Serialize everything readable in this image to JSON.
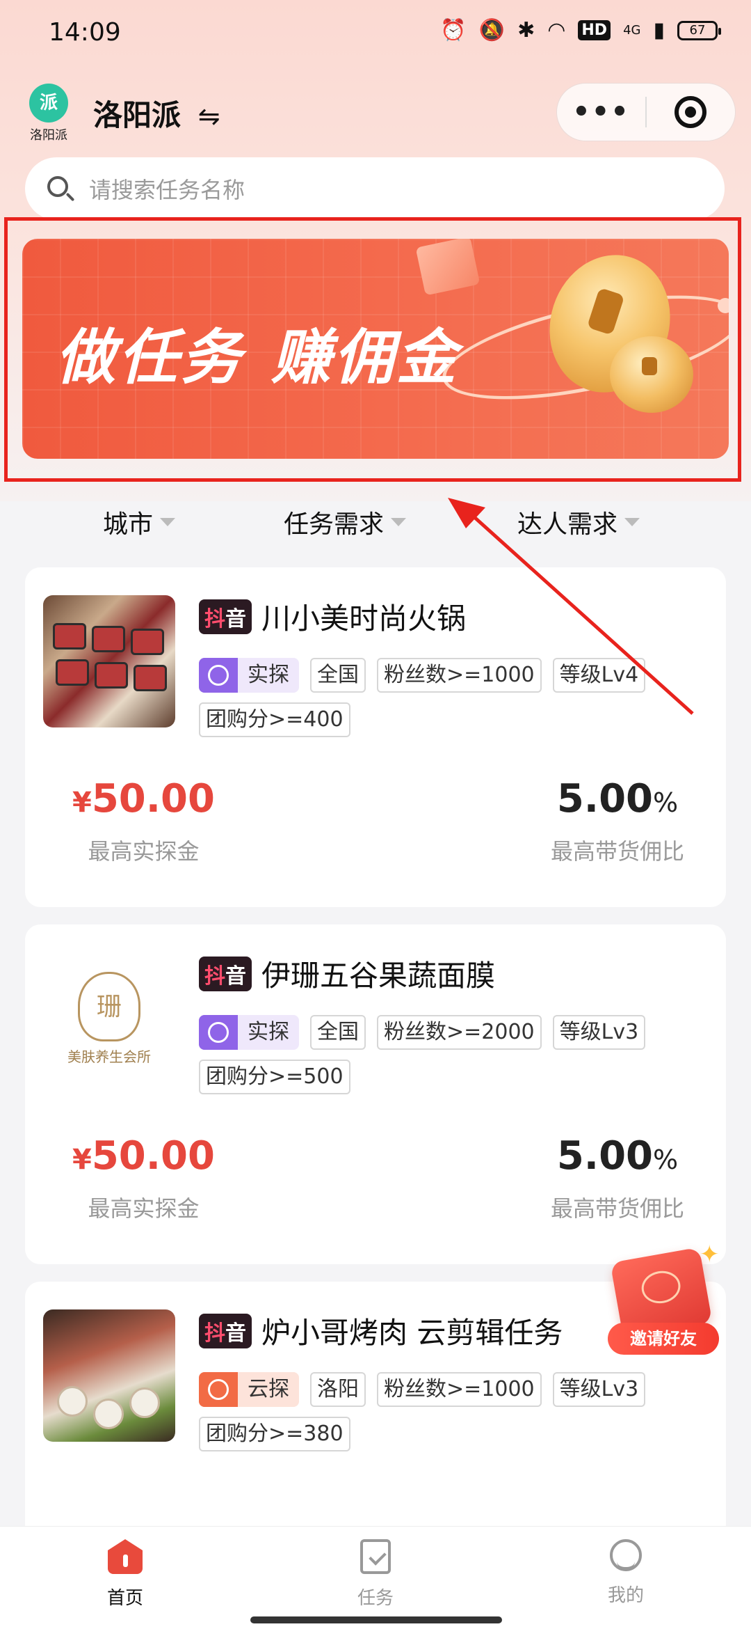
{
  "status_bar": {
    "time": "14:09",
    "network": "4G",
    "hd": "HD",
    "battery": "67"
  },
  "header": {
    "logo_char": "派",
    "logo_text": "洛阳派",
    "title": "洛阳派",
    "switch_glyph": "⇋",
    "more_glyph": "•••"
  },
  "search": {
    "placeholder": "请搜索任务名称"
  },
  "banner": {
    "text_left": "做任务",
    "text_right": "赚佣金"
  },
  "filters": [
    {
      "label": "城市"
    },
    {
      "label": "任务需求"
    },
    {
      "label": "达人需求"
    }
  ],
  "tasks": [
    {
      "platform_a": "抖",
      "platform_b": "音",
      "title": "川小美时尚火锅",
      "type": "实探",
      "tags": [
        "全国",
        "粉丝数>=1000",
        "等级Lv4",
        "团购分>=400"
      ],
      "price_currency": "¥",
      "price": "50.00",
      "price_label": "最高实探金",
      "ratio": "5.00",
      "ratio_unit": "%",
      "ratio_label": "最高带货佣比"
    },
    {
      "platform_a": "抖",
      "platform_b": "音",
      "title": "伊珊五谷果蔬面膜",
      "type": "实探",
      "thumb_caption": "美肤养生会所",
      "tags": [
        "全国",
        "粉丝数>=2000",
        "等级Lv3",
        "团购分>=500"
      ],
      "price_currency": "¥",
      "price": "50.00",
      "price_label": "最高实探金",
      "ratio": "5.00",
      "ratio_unit": "%",
      "ratio_label": "最高带货佣比"
    },
    {
      "platform_a": "抖",
      "platform_b": "音",
      "title": "炉小哥烤肉 云剪辑任务",
      "type": "云探",
      "tags": [
        "洛阳",
        "粉丝数>=1000",
        "等级Lv3",
        "团购分>=380"
      ]
    }
  ],
  "invite": {
    "label": "邀请好友"
  },
  "tab_bar": [
    {
      "label": "首页",
      "active": true
    },
    {
      "label": "任务",
      "active": false
    },
    {
      "label": "我的",
      "active": false
    }
  ],
  "colors": {
    "accent": "#e6473d",
    "active_tab": "#111111",
    "inactive_tab": "#999999",
    "highlight_frame": "#e8231d"
  }
}
